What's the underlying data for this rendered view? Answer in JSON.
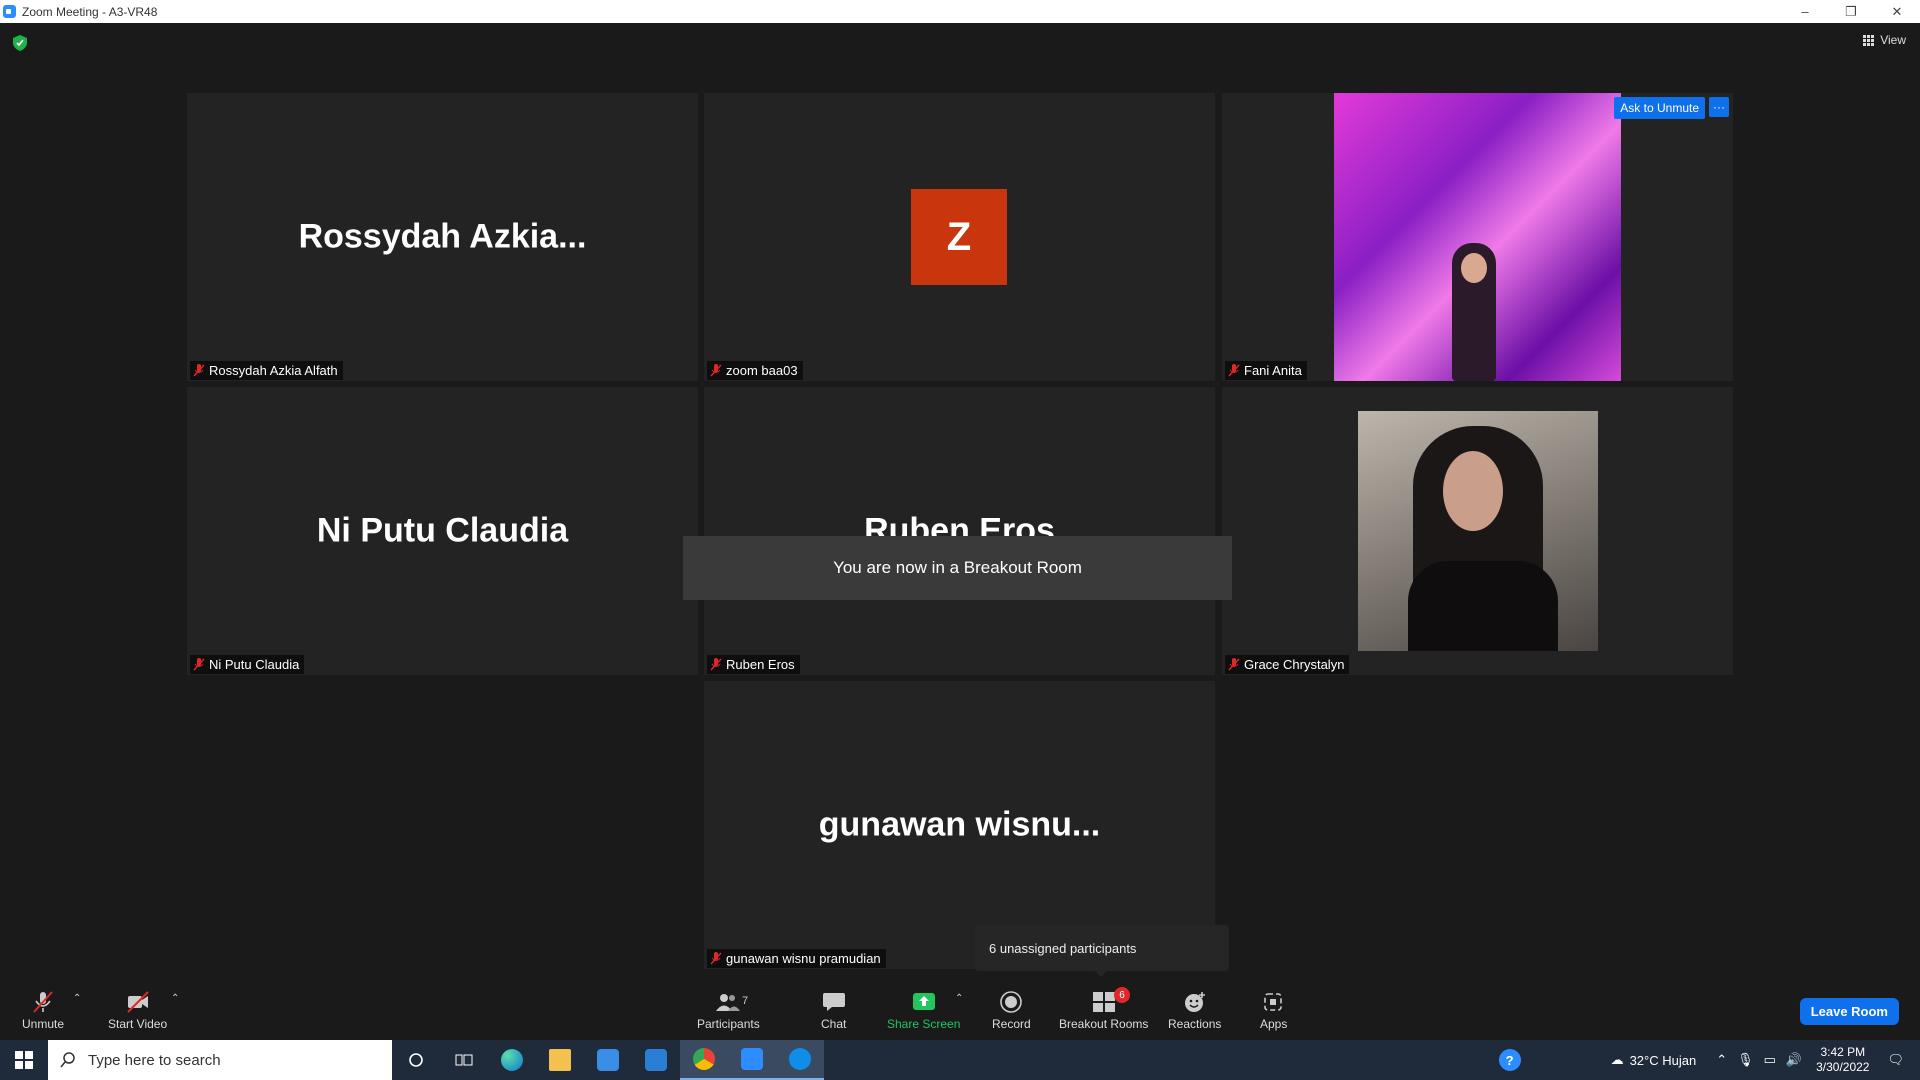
{
  "window": {
    "title": "Zoom Meeting - A3-VR48",
    "controls": [
      "–",
      "❐",
      "✕"
    ]
  },
  "top": {
    "view_label": "View"
  },
  "participants": [
    {
      "id": "rossydah",
      "display": "Rossydah  Azkia...",
      "name": "Rossydah Azkia Alfath"
    },
    {
      "id": "zoom",
      "avatar_letter": "Z",
      "name": "zoom baa03"
    },
    {
      "id": "fani",
      "name": "Fani Anita",
      "ask_unmute": "Ask to Unmute",
      "more": "···"
    },
    {
      "id": "niputu",
      "display": "Ni Putu Claudia",
      "name": "Ni Putu Claudia"
    },
    {
      "id": "ruben",
      "display": "Ruben Eros",
      "name": "Ruben Eros"
    },
    {
      "id": "grace",
      "name": "Grace Chrystalyn"
    },
    {
      "id": "gunawan",
      "display": "gunawan  wisnu...",
      "name": "gunawan wisnu pramudian"
    }
  ],
  "toast": "You are now in a Breakout Room",
  "tooltip": "6 unassigned participants",
  "toolbar": {
    "unmute": "Unmute",
    "start_video": "Start Video",
    "participants": "Participants",
    "participants_count": "7",
    "chat": "Chat",
    "share_screen": "Share Screen",
    "record": "Record",
    "breakout_rooms": "Breakout Rooms",
    "breakout_badge": "6",
    "reactions": "Reactions",
    "apps": "Apps",
    "leave": "Leave Room"
  },
  "taskbar": {
    "search_placeholder": "Type here to search",
    "weather": "32°C  Hujan",
    "time": "3:42 PM",
    "date": "3/30/2022"
  },
  "colors": {
    "accent": "#0e71eb",
    "share_green": "#22c55e",
    "avatar_orange": "#c9360e",
    "muted_red": "#e02828"
  }
}
